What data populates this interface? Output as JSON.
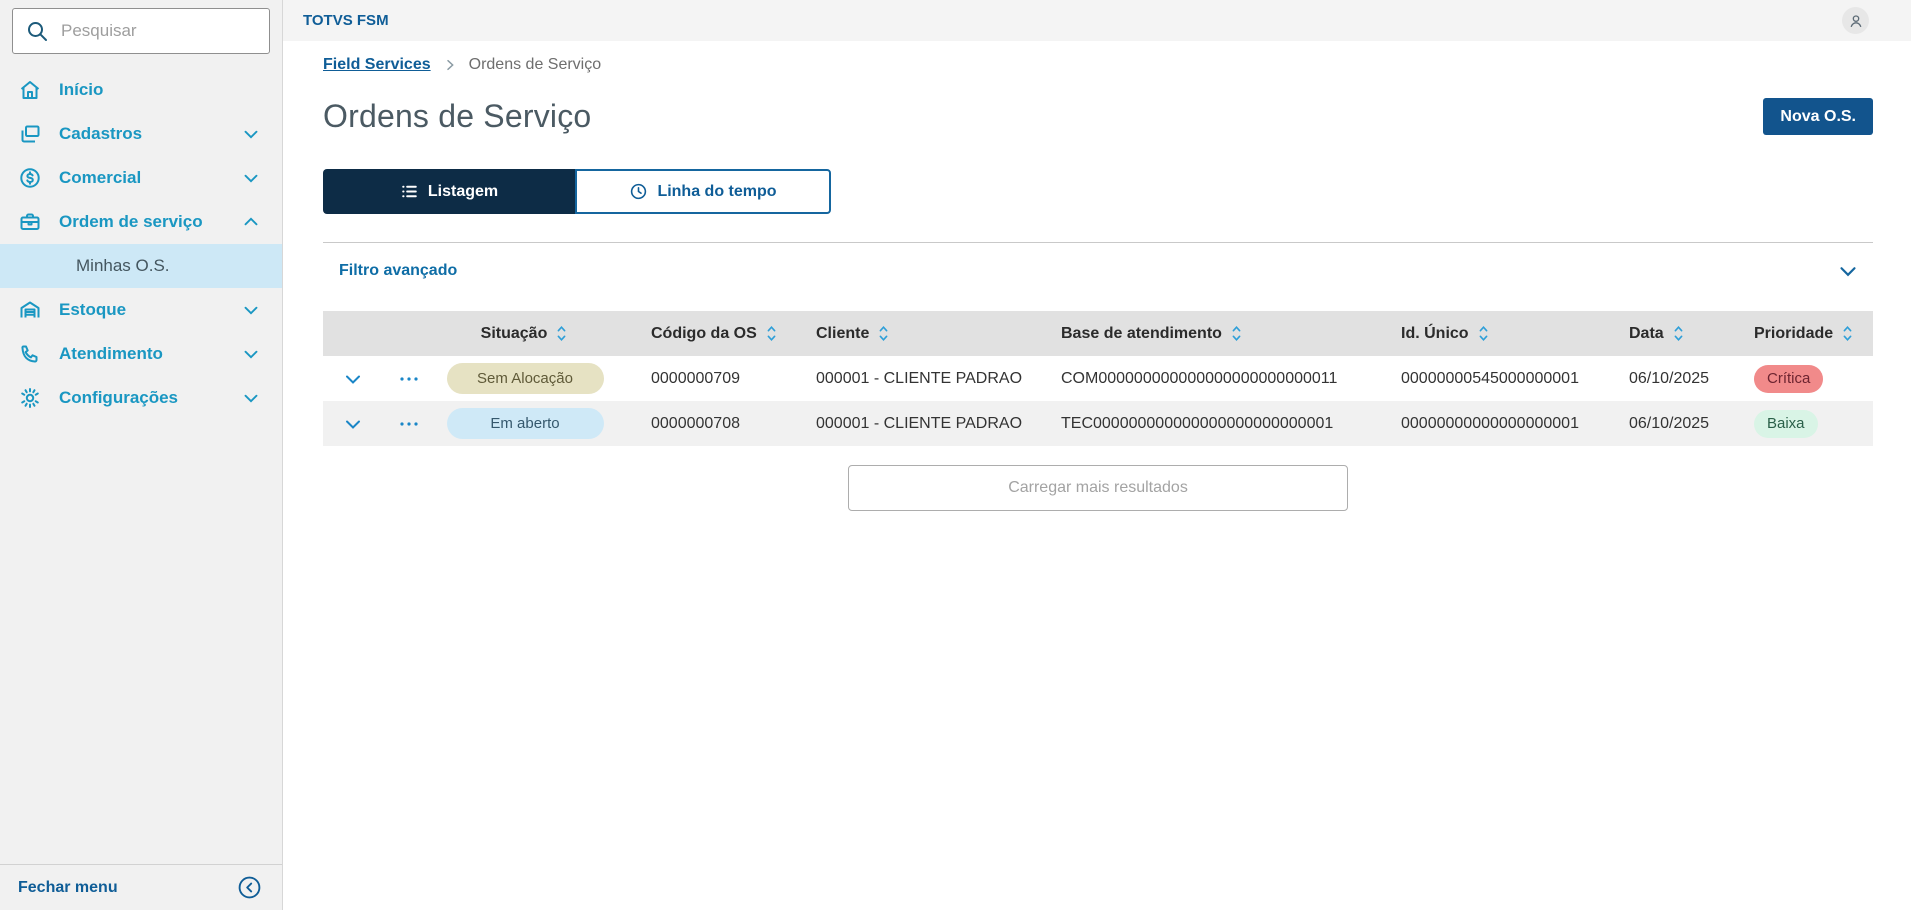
{
  "colors": {
    "primary_dark_blue": "#12548d",
    "active_tab_navy": "#0d2c46",
    "menu_blue": "#1a97c2",
    "link_blue": "#0f5d97",
    "submenu_highlight": "#cde8f6",
    "table_header_bg": "#e1e1e1",
    "row_alt_bg": "#f1f1f1",
    "badge_sem_alocacao_bg": "#e6e2c3",
    "badge_em_aberto_bg": "#cfe9f7",
    "badge_critica_bg": "#f18a8a",
    "badge_baixa_bg": "#d9f4e6"
  },
  "sidebar": {
    "search_placeholder": "Pesquisar",
    "items": [
      {
        "label": "Início",
        "icon": "home-icon",
        "chevron": ""
      },
      {
        "label": "Cadastros",
        "icon": "cards-icon",
        "chevron": "down"
      },
      {
        "label": "Comercial",
        "icon": "dollar-circle-icon",
        "chevron": "down"
      },
      {
        "label": "Ordem de serviço",
        "icon": "briefcase-icon",
        "chevron": "up"
      },
      {
        "label": "Estoque",
        "icon": "warehouse-icon",
        "chevron": "down"
      },
      {
        "label": "Atendimento",
        "icon": "phone-icon",
        "chevron": "down"
      },
      {
        "label": "Configurações",
        "icon": "gear-icon",
        "chevron": "down"
      }
    ],
    "active_subitem": "Minhas O.S.",
    "close_label": "Fechar menu"
  },
  "topbar": {
    "app_title": "TOTVS FSM"
  },
  "breadcrumb": {
    "parent": "Field Services",
    "current": "Ordens de Serviço"
  },
  "page": {
    "title": "Ordens de Serviço",
    "new_button": "Nova O.S."
  },
  "tabs": {
    "listagem": "Listagem",
    "linha_do_tempo": "Linha do tempo"
  },
  "filter": {
    "label": "Filtro avançado"
  },
  "table": {
    "headers": [
      "Situação",
      "Código da OS",
      "Cliente",
      "Base de atendimento",
      "Id. Único",
      "Data",
      "Prioridade"
    ],
    "rows": [
      {
        "situacao": "Sem Alocação",
        "codigo": "0000000709",
        "cliente": "000001 - CLIENTE PADRAO",
        "base": "COM000000000000000000000000011",
        "id_unico": "00000000545000000001",
        "data": "06/10/2025",
        "prioridade": "Crítica"
      },
      {
        "situacao": "Em aberto",
        "codigo": "0000000708",
        "cliente": "000001 - CLIENTE PADRAO",
        "base": "TEC000000000000000000000000001",
        "id_unico": "00000000000000000001",
        "data": "06/10/2025",
        "prioridade": "Baixa"
      }
    ],
    "load_more": "Carregar mais resultados"
  }
}
